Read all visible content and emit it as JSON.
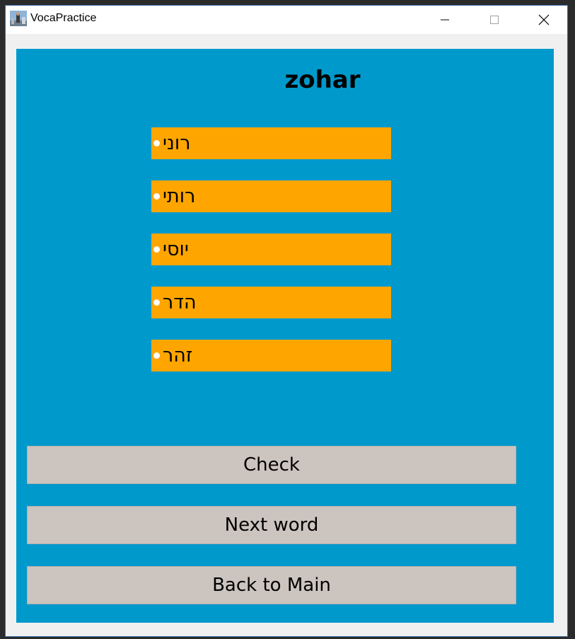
{
  "window": {
    "title": "VocaPractice",
    "icon": "app-photo-icon"
  },
  "quiz": {
    "word": "zohar",
    "options": [
      {
        "label": "רוני"
      },
      {
        "label": "רותי"
      },
      {
        "label": "יוסי"
      },
      {
        "label": "הדר"
      },
      {
        "label": "זהר"
      }
    ]
  },
  "actions": {
    "check": "Check",
    "next": "Next word",
    "back": "Back to Main"
  },
  "colors": {
    "content_bg": "#0099cc",
    "option_bg": "#ffa500",
    "button_bg": "#ccc4bf"
  }
}
